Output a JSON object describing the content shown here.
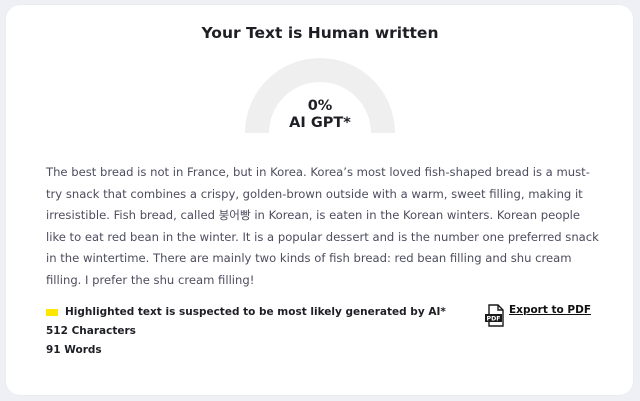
{
  "header": {
    "title": "Your Text is Human written"
  },
  "gauge": {
    "percent_label": "0%",
    "caption": "AI GPT*",
    "ai_fraction": 0
  },
  "content": {
    "text": "The best bread is not in France, but in Korea. Korea’s most loved fish-shaped bread is a must-try snack that combines a crispy, golden-brown outside with a warm, sweet filling, making it irresistible. Fish bread, called 붕어빵 in Korean, is eaten in the Korean winters. Korean people like to eat red bean in the winter. It is a popular dessert and is the number one preferred snack in the wintertime. There are mainly two kinds of fish bread: red bean filling and shu cream filling. I prefer the shu cream filling!"
  },
  "legend": {
    "highlight_color": "#ffe600",
    "highlight_note": "Highlighted text is suspected to be most likely generated by AI*"
  },
  "stats": {
    "characters": "512 Characters",
    "words": "91 Words"
  },
  "export": {
    "label": "Export to PDF",
    "icon": "pdf-icon"
  },
  "colors": {
    "gauge_track": "#efefef",
    "text": "#4d4d5f",
    "heading": "#1e1f24"
  }
}
